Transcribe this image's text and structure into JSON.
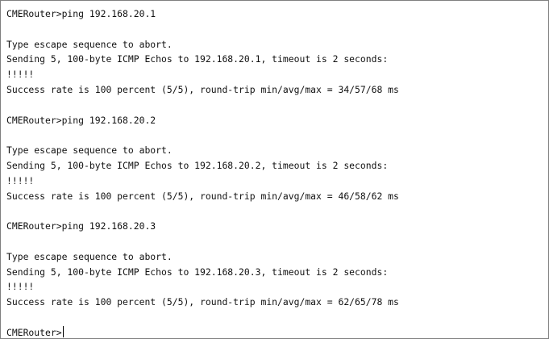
{
  "terminal": {
    "lines": [
      "CMERouter>ping 192.168.20.1",
      "",
      "Type escape sequence to abort.",
      "Sending 5, 100-byte ICMP Echos to 192.168.20.1, timeout is 2 seconds:",
      "!!!!!",
      "Success rate is 100 percent (5/5), round-trip min/avg/max = 34/57/68 ms",
      "",
      "CMERouter>ping 192.168.20.2",
      "",
      "Type escape sequence to abort.",
      "Sending 5, 100-byte ICMP Echos to 192.168.20.2, timeout is 2 seconds:",
      "!!!!!",
      "Success rate is 100 percent (5/5), round-trip min/avg/max = 46/58/62 ms",
      "",
      "CMERouter>ping 192.168.20.3",
      "",
      "Type escape sequence to abort.",
      "Sending 5, 100-byte ICMP Echos to 192.168.20.3, timeout is 2 seconds:",
      "!!!!!",
      "Success rate is 100 percent (5/5), round-trip min/avg/max = 62/65/78 ms",
      "",
      "CMERouter>"
    ]
  }
}
